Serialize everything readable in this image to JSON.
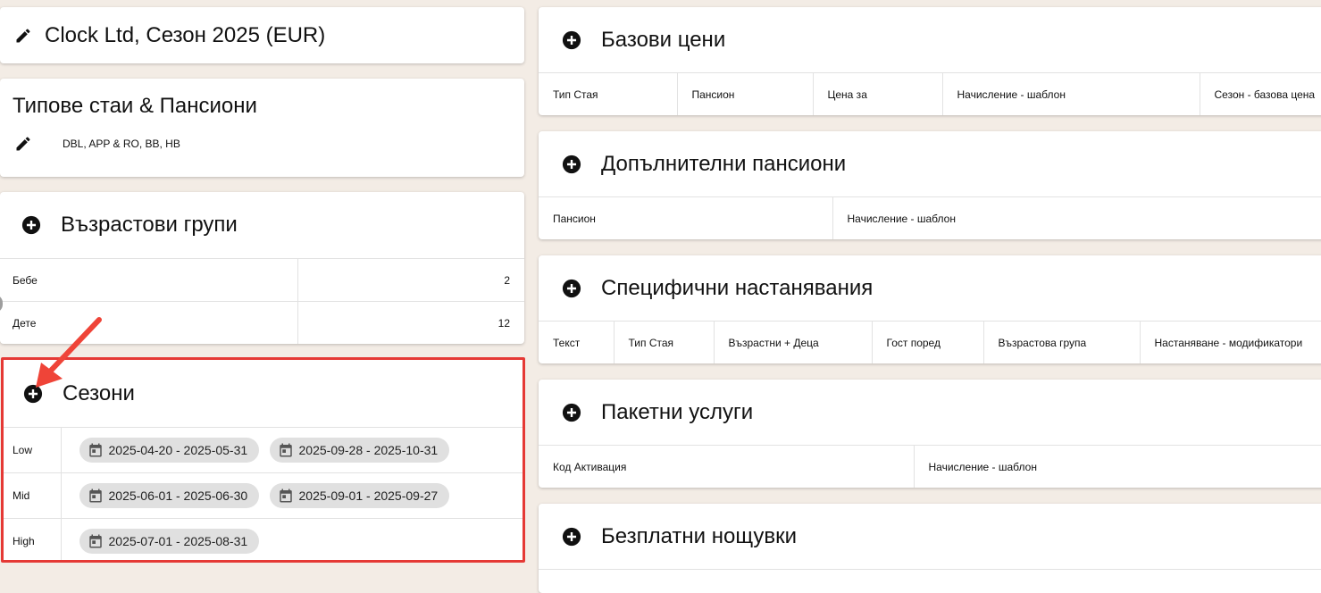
{
  "left": {
    "contract": {
      "title": "Clock Ltd, Сезон 2025 (EUR)",
      "edit_icon": "pencil-icon"
    },
    "room_types": {
      "title": "Типове стаи & Пансиони",
      "summary": "DBL, APP & RO, BB, HB",
      "edit_icon": "pencil-icon"
    },
    "age_groups": {
      "title": "Възрастови групи",
      "add_icon": "plus-circle-icon",
      "rows": [
        {
          "name": "Бебе",
          "max_age": "2"
        },
        {
          "name": "Дете",
          "max_age": "12"
        }
      ]
    },
    "seasons": {
      "title": "Сезони",
      "add_icon": "plus-circle-icon",
      "highlight_color": "#e53935",
      "rows": [
        {
          "name": "Low",
          "ranges": [
            "2025-04-20 - 2025-05-31",
            "2025-09-28 - 2025-10-31"
          ]
        },
        {
          "name": "Mid",
          "ranges": [
            "2025-06-01 - 2025-06-30",
            "2025-09-01 - 2025-09-27"
          ]
        },
        {
          "name": "High",
          "ranges": [
            "2025-07-01 - 2025-08-31"
          ]
        }
      ]
    }
  },
  "right": {
    "base_prices": {
      "title": "Базови цени",
      "columns": [
        "Тип Стая",
        "Пансион",
        "Цена за",
        "Начисление - шаблон",
        "Сезон - базова цена"
      ]
    },
    "extra_boards": {
      "title": "Допълнителни пансиони",
      "columns": [
        "Пансион",
        "Начисление - шаблон"
      ]
    },
    "specific_accommodations": {
      "title": "Специфични настанявания",
      "columns": [
        "Текст",
        "Тип Стая",
        "Възрастни + Деца",
        "Гост поред",
        "Възрастова група",
        "Настаняване - модификатори"
      ]
    },
    "package_services": {
      "title": "Пакетни услуги",
      "columns": [
        "Код Активация",
        "Начисление - шаблон"
      ]
    },
    "free_nights": {
      "title": "Безплатни нощувки"
    }
  }
}
